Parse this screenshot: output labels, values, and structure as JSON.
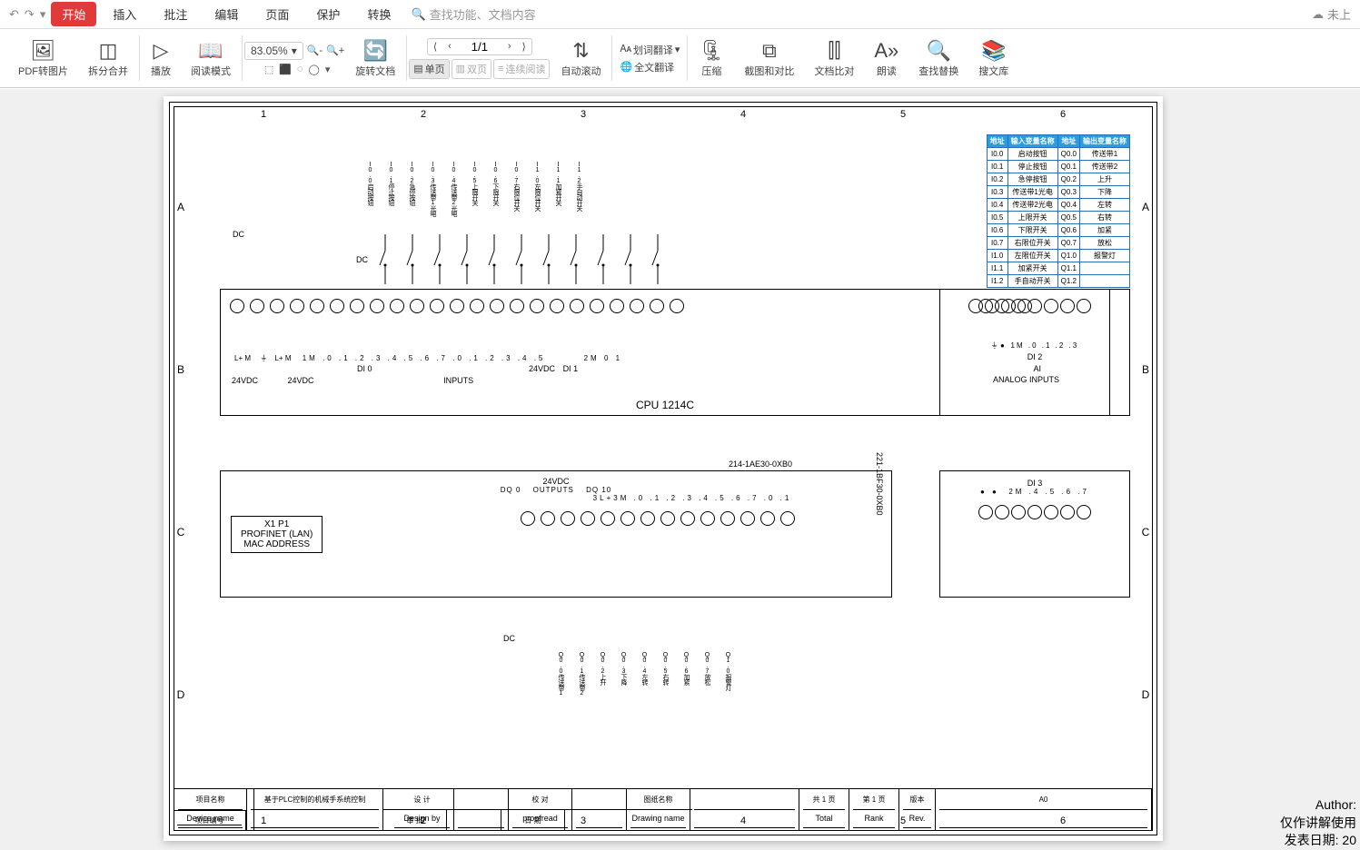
{
  "tabs": {
    "start": "开始",
    "insert": "插入",
    "annotate": "批注",
    "edit": "编辑",
    "page": "页面",
    "protect": "保护",
    "convert": "转换"
  },
  "search_placeholder": "查找功能、文档内容",
  "cloud_status": "未上",
  "ribbon": {
    "pdf2img": "PDF转图片",
    "split": "拆分合并",
    "play": "播放",
    "readmode": "阅读模式",
    "zoom": "83.05%",
    "rotate": "旋转文档",
    "singlepage": "单页",
    "doublepage": "双页",
    "continuous": "连续阅读",
    "autoscroll": "自动滚动",
    "page_current": "1/1",
    "wordtrans": "划词翻译",
    "fulltrans": "全文翻译",
    "compress": "压缩",
    "screencap": "截图和对比",
    "doccompare": "文档比对",
    "readaloud": "朗读",
    "findreplace": "查找替换",
    "searchlib": "搜文库"
  },
  "ruler_top": [
    "1",
    "2",
    "3",
    "4",
    "5",
    "6"
  ],
  "ruler_side": [
    "A",
    "B",
    "C",
    "D"
  ],
  "io_table": {
    "headers": [
      "地址",
      "输入变量名称",
      "地址",
      "输出变量名称"
    ],
    "rows": [
      [
        "I0.0",
        "启动按钮",
        "Q0.0",
        "传送带1"
      ],
      [
        "I0.1",
        "停止按钮",
        "Q0.1",
        "传送带2"
      ],
      [
        "I0.2",
        "急停按钮",
        "Q0.2",
        "上升"
      ],
      [
        "I0.3",
        "传送带1光电",
        "Q0.3",
        "下降"
      ],
      [
        "I0.4",
        "传送带2光电",
        "Q0.4",
        "左转"
      ],
      [
        "I0.5",
        "上限开关",
        "Q0.5",
        "右转"
      ],
      [
        "I0.6",
        "下限开关",
        "Q0.6",
        "加紧"
      ],
      [
        "I0.7",
        "右限位开关",
        "Q0.7",
        "放松"
      ],
      [
        "I1.0",
        "左限位开关",
        "Q1.0",
        "报警灯"
      ],
      [
        "I1.1",
        "加紧开关",
        "Q1.1",
        ""
      ],
      [
        "I1.2",
        "手自动开关",
        "Q1.2",
        ""
      ]
    ]
  },
  "input_labels": [
    "I0.0启动按钮",
    "I0.1停止按钮",
    "I0.2急停按钮",
    "I0.3传送带1光电",
    "I0.4传送带2光电",
    "I0.5上限开关",
    "I0.6下限开关",
    "I0.7右限位开关",
    "I1.0左限位开关",
    "I1.1加紧开关",
    "I1.2手自动开关"
  ],
  "output_labels": [
    "Q0.0传送带1",
    "Q0.1传送带2",
    "Q0.2上升",
    "Q0.3下降",
    "Q0.4左转",
    "Q0.5右转",
    "Q0.6加紧",
    "Q0.7放松",
    "Q1.0报警灯"
  ],
  "cpu": {
    "name": "CPU 1214C",
    "dc1": "DC",
    "dc2": "DC",
    "dc3": "DC",
    "l24_1": "24VDC",
    "l24_2": "24VDC",
    "l24_3": "24VDC",
    "inputs_lbl": "INPUTS",
    "outputs_lbl": "OUTPUTS",
    "analog_lbl": "ANALOG INPUTS",
    "pins_top_left": "L+  M",
    "pins_top_left2": "L+  M",
    "pins_1m": "1M .0 .1 .2 .3 .4 .5 .6 .7 .0 .1 .2 .3 .4 .5",
    "pins_di0": "DI 0",
    "pins_di1": "DI 1",
    "pins_di2": "DI 2",
    "pins_di3": "DI 3",
    "pins_ai": "2M 0 1",
    "pins_ai2": "AI",
    "ext_top": "1M .0 .1 .2 .3",
    "pins_dq_top": "24VDC",
    "pins_dq": "3L+3M .0 .1 .2 .3 .4 .5 .6 .7 .0 .1",
    "pins_dq0": "DQ 0",
    "pins_dq10": "DQ 10",
    "ext_bot": "2M .4 .5 .6 .7",
    "part1": "214-1AE30-0XB0",
    "part2": "221-1BF30-0XB0"
  },
  "lan": {
    "h": "X1 P1",
    "l1": "PROFINET (LAN)",
    "l2": "MAC ADDRESS"
  },
  "titleblock": {
    "proj_name_l": "项目名称",
    "proj_name_en": "Device name",
    "proj_name_v": "基于PLC控制的机械手系统控制",
    "proj_code_l": "项目编号",
    "proj_code_en": "Device number",
    "design": "设 计",
    "design_en": "Design by",
    "approve": "审 批",
    "approve_en": "Approve by",
    "proof": "校 对",
    "proof_en": "proofread",
    "date": "日 期",
    "date_en": "DateTime",
    "dwg": "图纸名称",
    "dwg_en": "Drawing name",
    "total": "共 1 页",
    "total_en": "Total",
    "rank": "第 1 页",
    "rank_en": "Rank",
    "rev": "版本",
    "rev_en": "Rev.",
    "rev_v": "A0"
  },
  "watermark": {
    "author": "Author:",
    "note": "仅作讲解使用",
    "pub": "发表日期: 20"
  }
}
